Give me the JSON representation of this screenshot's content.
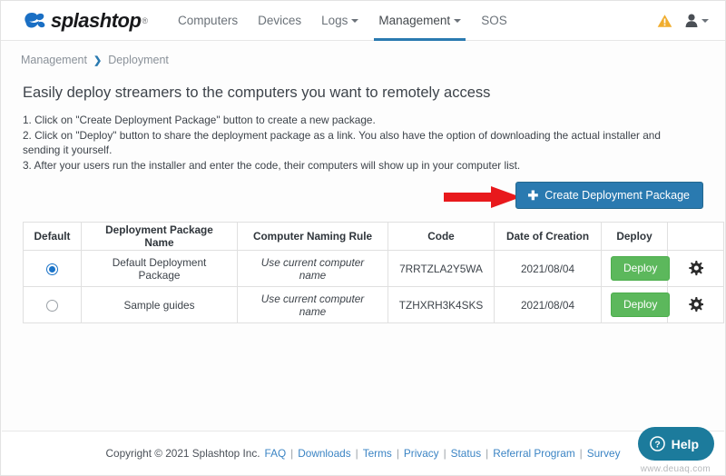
{
  "navbar": {
    "brand": "splashtop",
    "brand_registered": "®",
    "items": [
      {
        "label": "Computers",
        "active": false,
        "has_caret": false
      },
      {
        "label": "Devices",
        "active": false,
        "has_caret": false
      },
      {
        "label": "Logs",
        "active": false,
        "has_caret": true
      },
      {
        "label": "Management",
        "active": true,
        "has_caret": true
      },
      {
        "label": "SOS",
        "active": false,
        "has_caret": false
      }
    ],
    "warning_icon": "warning-triangle-icon",
    "user_icon": "user-account-icon",
    "colors": {
      "accent": "#2a7ab0",
      "warning": "#f0ad2e"
    }
  },
  "breadcrumb": {
    "parent": "Management",
    "separator": "❯",
    "current": "Deployment"
  },
  "main": {
    "headline": "Easily deploy streamers to the computers you want to remotely access",
    "steps": [
      "1. Click on \"Create Deployment Package\" button to create a new package.",
      "2. Click on \"Deploy\" button to share the deployment package as a link. You also have the option of downloading the actual installer and sending it yourself.",
      "3. After your users run the installer and enter the code, their computers will show up in your computer list."
    ],
    "create_button": {
      "label": "Create Deployment Package",
      "icon": "plus-icon",
      "color": "#2a7ab0"
    },
    "annotation": {
      "type": "red-arrow-right",
      "color": "#e8191c"
    }
  },
  "table": {
    "headers": [
      "Default",
      "Deployment Package Name",
      "Computer Naming Rule",
      "Code",
      "Date of Creation",
      "Deploy",
      ""
    ],
    "rows": [
      {
        "default_selected": true,
        "name": "Default Deployment Package",
        "naming_rule": "Use current computer name",
        "code": "7RRTZLA2Y5WA",
        "date": "2021/08/04",
        "deploy_label": "Deploy",
        "settings_icon": "gear-icon"
      },
      {
        "default_selected": false,
        "name": "Sample guides",
        "naming_rule": "Use current computer name",
        "code": "TZHXRH3K4SKS",
        "date": "2021/08/04",
        "deploy_label": "Deploy",
        "settings_icon": "gear-icon"
      }
    ],
    "deploy_color": "#5cb85c"
  },
  "footer": {
    "copyright": "Copyright © 2021 Splashtop Inc.",
    "links": [
      "FAQ",
      "Downloads",
      "Terms",
      "Privacy",
      "Status",
      "Referral Program",
      "Survey"
    ],
    "separator": "|"
  },
  "help_widget": {
    "label": "Help",
    "icon": "question-circle-icon",
    "color": "#1c7b9c"
  },
  "watermark": "www.deuaq.com"
}
